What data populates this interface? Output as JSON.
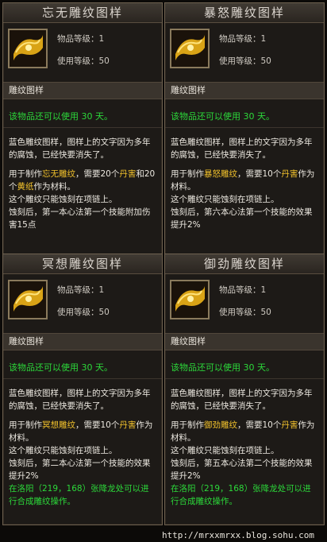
{
  "cards": [
    {
      "title": "忘无雕纹图样",
      "item_level": "物品等级：1",
      "use_level": "使用等级：50",
      "type": "雕纹图样",
      "available": "该物品还可以使用 30 天。",
      "desc1": "蓝色雕纹图样，图样上的文字因为多年的腐蚀，已经快要消失了。",
      "make_pre": "用于制作",
      "make_name": "忘无雕纹",
      "make_mid": "，需要20个",
      "make_mat": "丹害",
      "make_mid2": "和20个",
      "make_mat2": "黄纸",
      "make_post": "作为材料。",
      "line_neck": "这个雕纹只能蚀刻在项链上。",
      "effect": "蚀刻后，第一本心法第一个技能附加伤害15点",
      "extra": ""
    },
    {
      "title": "暴怒雕纹图样",
      "item_level": "物品等级：1",
      "use_level": "使用等级：50",
      "type": "雕纹图样",
      "available": "该物品还可以使用 30 天。",
      "desc1": "蓝色雕纹图样，图样上的文字因为多年的腐蚀，已经快要消失了。",
      "make_pre": "用于制作",
      "make_name": "暴怒雕纹",
      "make_mid": "，需要10个",
      "make_mat": "丹害",
      "make_mid2": "",
      "make_mat2": "",
      "make_post": "作为材料。",
      "line_neck": "这个雕纹只能蚀刻在项链上。",
      "effect": "蚀刻后，第六本心法第一个技能的效果提升2%",
      "extra": ""
    },
    {
      "title": "冥想雕纹图样",
      "item_level": "物品等级：1",
      "use_level": "使用等级：50",
      "type": "雕纹图样",
      "available": "该物品还可以使用 30 天。",
      "desc1": "蓝色雕纹图样，图样上的文字因为多年的腐蚀，已经快要消失了。",
      "make_pre": "用于制作",
      "make_name": "冥想雕纹",
      "make_mid": "，需要10个",
      "make_mat": "丹害",
      "make_mid2": "",
      "make_mat2": "",
      "make_post": "作为材料。",
      "line_neck": "这个雕纹只能蚀刻在项链上。",
      "effect": "蚀刻后，第二本心法第一个技能的效果提升2%",
      "extra": "在洛阳（219，168）张降龙处可以进行合成雕纹操作。"
    },
    {
      "title": "御劲雕纹图样",
      "item_level": "物品等级：1",
      "use_level": "使用等级：50",
      "type": "雕纹图样",
      "available": "该物品还可以使用 30 天。",
      "desc1": "蓝色雕纹图样，图样上的文字因为多年的腐蚀，已经快要消失了。",
      "make_pre": "用于制作",
      "make_name": "御劲雕纹",
      "make_mid": "，需要10个",
      "make_mat": "丹害",
      "make_mid2": "",
      "make_mat2": "",
      "make_post": "作为材料。",
      "line_neck": "这个雕纹只能蚀刻在项链上。",
      "effect": "蚀刻后，第五本心法第二个技能的效果提升2%",
      "extra": "在洛阳（219，168）张降龙处可以进行合成雕纹操作。"
    }
  ],
  "watermark": "http://mrxxmrxx.blog.sohu.com",
  "colors": {
    "highlight": "#f0c02c",
    "available": "#2cd83a",
    "panel": "#1d1a17"
  },
  "icon": "golden-scroll-icon"
}
